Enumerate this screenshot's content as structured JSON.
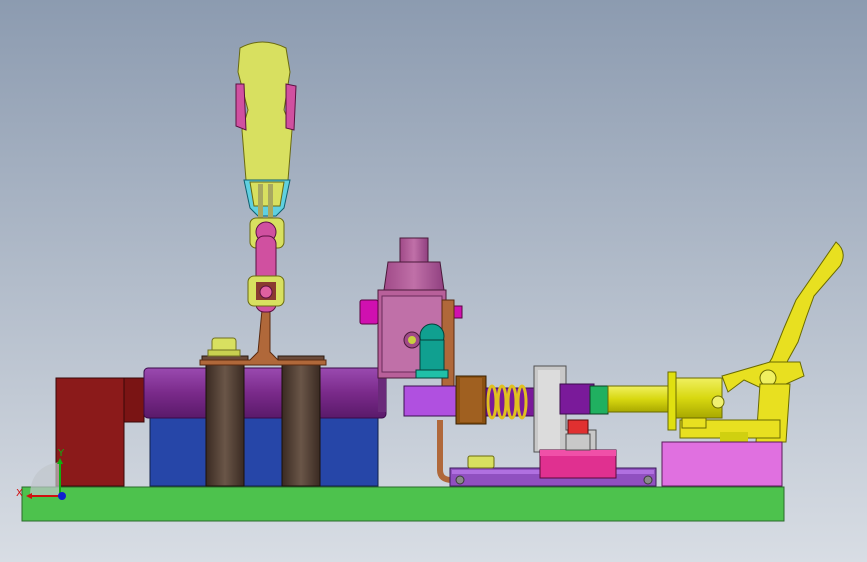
{
  "viewport": {
    "background_top": "#8c9bb0",
    "background_bottom": "#d8dde4"
  },
  "model": {
    "parts": [
      {
        "name": "base-plate",
        "color": "#4dc24d"
      },
      {
        "name": "red-block",
        "color": "#8b1a1a"
      },
      {
        "name": "blue-block",
        "color": "#2646a8"
      },
      {
        "name": "purple-cylinder",
        "color": "#7a2a8a"
      },
      {
        "name": "dark-post",
        "color": "#4a3a30"
      },
      {
        "name": "yellow-clamp-arm",
        "color": "#d8e060"
      },
      {
        "name": "pink-pivot",
        "color": "#d050a0"
      },
      {
        "name": "copper-bracket",
        "color": "#b0683a"
      },
      {
        "name": "mauve-valve-body",
        "color": "#b8609a"
      },
      {
        "name": "magenta-fitting",
        "color": "#d010b0"
      },
      {
        "name": "teal-connector",
        "color": "#10a090"
      },
      {
        "name": "violet-housing",
        "color": "#b050e0"
      },
      {
        "name": "brown-nut",
        "color": "#8a5010"
      },
      {
        "name": "yellow-spring",
        "color": "#e0c020"
      },
      {
        "name": "grey-bracket",
        "color": "#c8c8c8"
      },
      {
        "name": "green-collar",
        "color": "#20b060"
      },
      {
        "name": "yellow-shaft",
        "color": "#e0e010"
      },
      {
        "name": "yellow-toggle-clamp",
        "color": "#e8e020"
      },
      {
        "name": "pink-base-block",
        "color": "#e070e0"
      },
      {
        "name": "violet-rail",
        "color": "#9050c0"
      },
      {
        "name": "hot-pink-slider",
        "color": "#e03090"
      }
    ]
  },
  "triad": {
    "x_label": "X",
    "y_label": "Y",
    "x_color": "#d01010",
    "y_color": "#10b010",
    "z_color": "#1020d0"
  }
}
